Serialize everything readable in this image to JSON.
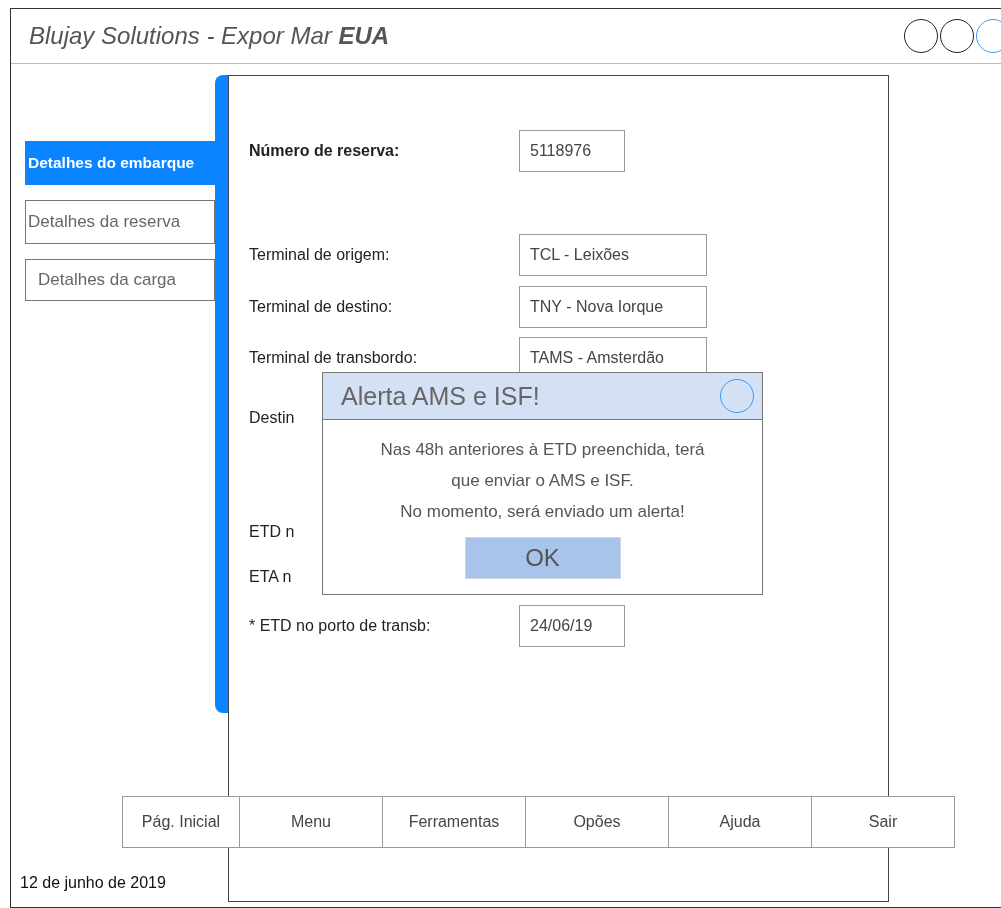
{
  "window": {
    "title": "Blujay Solutions - Expor Mar **EUA**",
    "controls": [
      {
        "kind": "plain"
      },
      {
        "kind": "plain"
      },
      {
        "kind": "accent"
      }
    ]
  },
  "sidebar": {
    "items": [
      {
        "label": "Detalhes do embarque",
        "selected": true
      },
      {
        "label": "Detalhes da reserva",
        "selected": false
      },
      {
        "label": "Detalhes da carga",
        "selected": false
      }
    ]
  },
  "form": {
    "fields": [
      {
        "label": "Número de reserva:",
        "value": "5118976",
        "bold": true
      },
      {
        "label": "Terminal de origem:",
        "value": "TCL - Leixões",
        "bold": false
      },
      {
        "label": "Terminal de destino:",
        "value": "TNY - Nova Iorque",
        "bold": false
      },
      {
        "label": "Terminal de transbordo:",
        "value": "TAMS - Amsterdão",
        "bold": false
      },
      {
        "label": "Destin",
        "bold": false
      },
      {
        "label": "ETD n",
        "bold": false
      },
      {
        "label": "ETA n",
        "bold": false
      },
      {
        "label": "* ETD no porto de transb:",
        "value": "24/06/19",
        "bold": false
      }
    ]
  },
  "dialog": {
    "title": "Alerta AMS e ISF!",
    "message": [
      "Nas 48h anteriores à ETD preenchida, terá",
      "que enviar o AMS e ISF.",
      "No momento, será enviado um alerta!"
    ],
    "button": "OK"
  },
  "footer_nav": [
    "Pág. Inicial",
    "Menu",
    "Ferramentas",
    "Opões",
    "Ajuda",
    "Sair"
  ],
  "status_bar": {
    "date": "12 de junho de 2019"
  }
}
